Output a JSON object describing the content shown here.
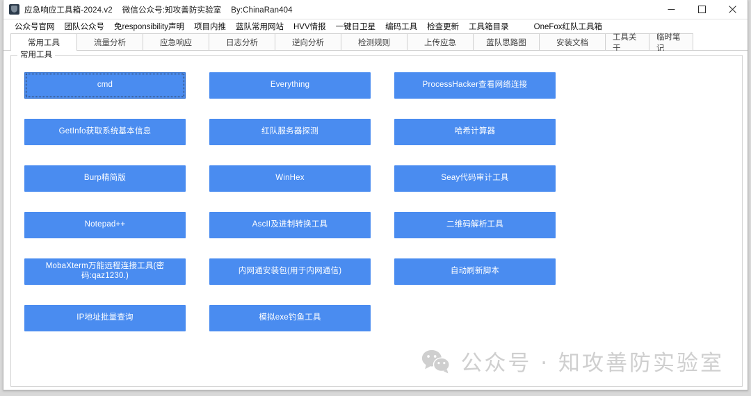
{
  "window": {
    "icon": "shield-icon",
    "title_main": "应急响应工具箱-2024.v2",
    "title_wechat": "微信公众号:知攻善防实验室",
    "title_author": "By:ChinaRan404",
    "controls": {
      "minimize": "minimize-button",
      "maximize": "maximize-button",
      "close": "close-button"
    }
  },
  "menubar": {
    "items": [
      {
        "label": "公众号官网"
      },
      {
        "label": "团队公众号"
      },
      {
        "label": "免responsibility声明"
      },
      {
        "label": "项目内推"
      },
      {
        "label": "蓝队常用网站"
      },
      {
        "label": "HVV情报"
      },
      {
        "label": "一键日卫星"
      },
      {
        "label": "编码工具"
      },
      {
        "label": "检查更新"
      },
      {
        "label": "工具箱目录"
      },
      {
        "label": "OneFox红队工具箱"
      }
    ]
  },
  "tabs": [
    {
      "label": "常用工具",
      "active": true
    },
    {
      "label": "流量分析",
      "active": false
    },
    {
      "label": "应急响应",
      "active": false
    },
    {
      "label": "日志分析",
      "active": false
    },
    {
      "label": "逆向分析",
      "active": false
    },
    {
      "label": "检测规则",
      "active": false
    },
    {
      "label": "上传应急",
      "active": false
    },
    {
      "label": "蓝队思路图",
      "active": false
    },
    {
      "label": "安装文档",
      "active": false
    },
    {
      "label": "工具关于",
      "active": false
    },
    {
      "label": "临时笔记",
      "active": false
    }
  ],
  "groupbox": {
    "title": "常用工具"
  },
  "tools": [
    {
      "label": "cmd",
      "focused": true
    },
    {
      "label": "Everything",
      "focused": false
    },
    {
      "label": "ProcessHacker查看网络连接",
      "focused": false
    },
    {
      "label": "GetInfo获取系统基本信息",
      "focused": false
    },
    {
      "label": "红队服务器探测",
      "focused": false
    },
    {
      "label": "哈希计算器",
      "focused": false
    },
    {
      "label": "Burp精简版",
      "focused": false
    },
    {
      "label": "WinHex",
      "focused": false
    },
    {
      "label": "Seay代码审计工具",
      "focused": false
    },
    {
      "label": "Notepad++",
      "focused": false
    },
    {
      "label": "AscII及进制转换工具",
      "focused": false
    },
    {
      "label": "二维码解析工具",
      "focused": false
    },
    {
      "label": "MobaXterm万能远程连接工具(密码:qaz1230.)",
      "focused": false
    },
    {
      "label": "内网通安装包(用于内网通信)",
      "focused": false
    },
    {
      "label": "自动刷新脚本",
      "focused": false
    },
    {
      "label": "IP地址批量查询",
      "focused": false
    },
    {
      "label": "模拟exe钓鱼工具",
      "focused": false
    }
  ],
  "watermark": {
    "icon": "wechat-icon",
    "text": "公众号 · 知攻善防实验室"
  },
  "colors": {
    "button_blue": "#4a8cf0",
    "watermark_gray": "#cfcfcf",
    "window_bg": "#ffffff"
  }
}
